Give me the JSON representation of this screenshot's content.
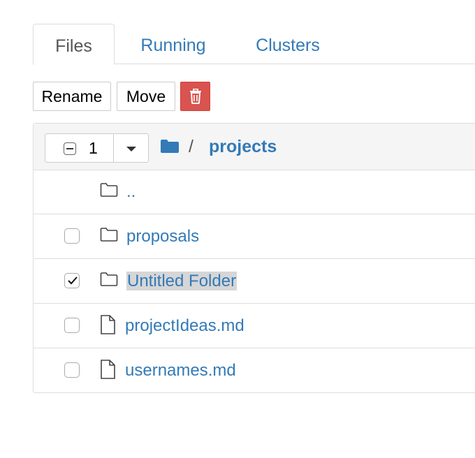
{
  "tabs": [
    {
      "label": "Files",
      "active": true
    },
    {
      "label": "Running",
      "active": false
    },
    {
      "label": "Clusters",
      "active": false
    }
  ],
  "toolbar": {
    "rename_label": "Rename",
    "move_label": "Move",
    "delete_icon": "trash-icon",
    "delete_color": "#d9534f"
  },
  "file_list": {
    "selected_count": "1",
    "breadcrumb": {
      "separator": "/",
      "current": "projects"
    },
    "rows": [
      {
        "name": "..",
        "type": "folder",
        "checkbox": false,
        "checked": false
      },
      {
        "name": "proposals",
        "type": "folder",
        "checkbox": true,
        "checked": false
      },
      {
        "name": "Untitled Folder",
        "type": "folder",
        "checkbox": true,
        "checked": true,
        "highlighted": true
      },
      {
        "name": "projectIdeas.md",
        "type": "file",
        "checkbox": true,
        "checked": false
      },
      {
        "name": "usernames.md",
        "type": "file",
        "checkbox": true,
        "checked": false
      }
    ]
  },
  "colors": {
    "link": "#337ab7",
    "border": "#dddddd",
    "header_bg": "#f5f5f5"
  }
}
